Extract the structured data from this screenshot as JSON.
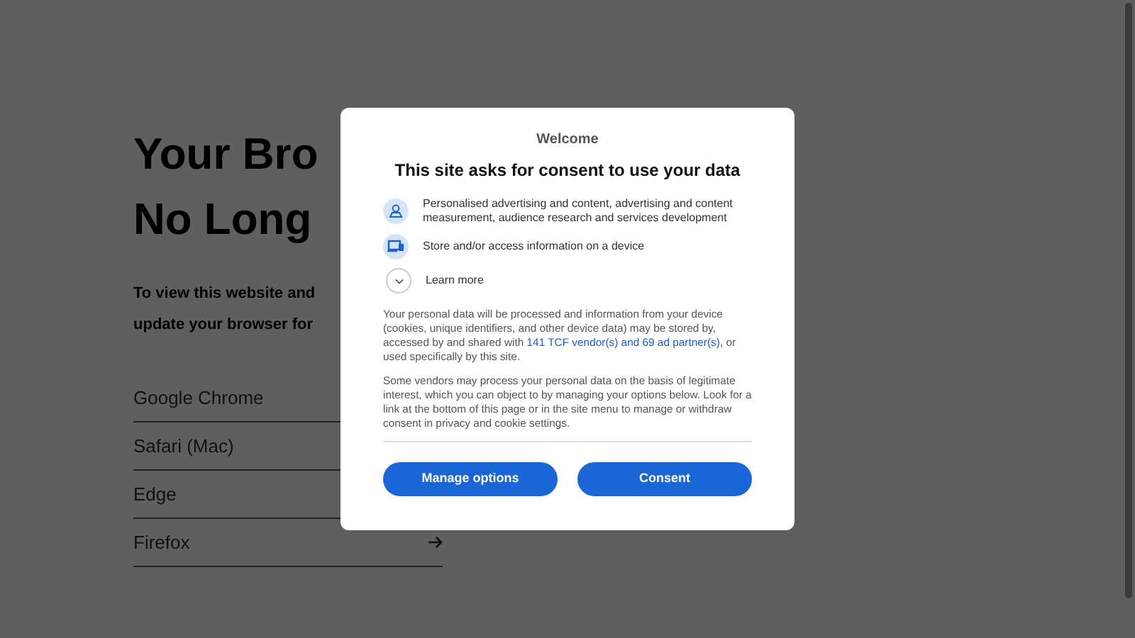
{
  "page": {
    "heading_lines": [
      "Your Bro",
      "No Long"
    ],
    "intro_lines": [
      "To view this website and",
      "update your browser for"
    ],
    "browsers": [
      {
        "label": "Google Chrome",
        "arrow": false
      },
      {
        "label": "Safari (Mac)",
        "arrow": false
      },
      {
        "label": "Edge",
        "arrow": false
      },
      {
        "label": "Firefox",
        "arrow": true
      }
    ]
  },
  "dialog": {
    "eyebrow": "Welcome",
    "title": "This site asks for consent to use your data",
    "purposes": [
      {
        "kind": "person",
        "text": "Personalised advertising and content, advertising and content measurement, audience research and services development"
      },
      {
        "kind": "device",
        "text": "Store and/or access information on a device"
      }
    ],
    "learn_more": {
      "label": "Learn more",
      "expanded": false
    },
    "paragraphs": [
      {
        "before": "Your personal data will be processed and information from your device (cookies, unique identifiers, and other device data) may be stored by, accessed by and shared with ",
        "link": "141 TCF vendor(s) and 69 ad partner(s)",
        "after": ", or used specifically by this site."
      },
      {
        "before": "Some vendors may process your personal data on the basis of legitimate interest, which you can object to by managing your options below. Look for a link at the bottom of this page or in the site menu to manage or withdraw consent in privacy and cookie settings."
      }
    ],
    "buttons": [
      "Manage options",
      "Consent"
    ]
  }
}
